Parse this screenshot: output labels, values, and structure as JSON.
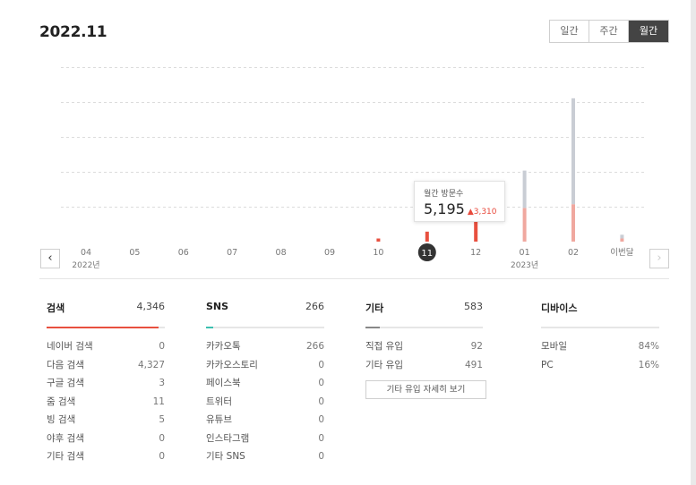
{
  "title": "2022.11",
  "period_tabs": [
    {
      "label": "일간",
      "active": false
    },
    {
      "label": "주간",
      "active": false
    },
    {
      "label": "월간",
      "active": true
    }
  ],
  "chart_data": {
    "type": "bar",
    "stacked": true,
    "categories": [
      "04",
      "05",
      "06",
      "07",
      "08",
      "09",
      "10",
      "11",
      "12",
      "01",
      "02",
      "이번달"
    ],
    "year_labels": {
      "04": "2022년",
      "01": "2023년"
    },
    "selected": "11",
    "series": [
      {
        "color": "#e8503f",
        "values": [
          0,
          0,
          0,
          0,
          0,
          0,
          250,
          800,
          1700,
          2700,
          3000,
          250
        ]
      },
      {
        "color": "#c9cdd4",
        "values": [
          0,
          0,
          0,
          0,
          0,
          0,
          0,
          0,
          0,
          3000,
          8500,
          300
        ]
      }
    ],
    "highlight_colors": {
      "selected": "#e8503f",
      "other": "#f0a89f"
    },
    "ylim": [
      0,
      14000
    ],
    "grid": true,
    "tooltip": {
      "label": "월간 방문수",
      "value": "5,195",
      "delta": "3,310",
      "delta_color": "#e84a3c"
    }
  },
  "stats": [
    {
      "title": "검색",
      "total": "4,346",
      "bar_color": "#e8503f",
      "bar_pct": 0.95,
      "rows": [
        {
          "label": "네이버 검색",
          "value": "0"
        },
        {
          "label": "다음 검색",
          "value": "4,327"
        },
        {
          "label": "구글 검색",
          "value": "3"
        },
        {
          "label": "줌 검색",
          "value": "11"
        },
        {
          "label": "빙 검색",
          "value": "5"
        },
        {
          "label": "야후 검색",
          "value": "0"
        },
        {
          "label": "기타 검색",
          "value": "0"
        }
      ]
    },
    {
      "title": "SNS",
      "total": "266",
      "bar_color": "#3cc0b0",
      "bar_pct": 0.06,
      "rows": [
        {
          "label": "카카오톡",
          "value": "266"
        },
        {
          "label": "카카오스토리",
          "value": "0"
        },
        {
          "label": "페이스북",
          "value": "0"
        },
        {
          "label": "트위터",
          "value": "0"
        },
        {
          "label": "유튜브",
          "value": "0"
        },
        {
          "label": "인스타그램",
          "value": "0"
        },
        {
          "label": "기타 SNS",
          "value": "0"
        }
      ]
    },
    {
      "title": "기타",
      "total": "583",
      "bar_color": "#888888",
      "bar_pct": 0.12,
      "rows": [
        {
          "label": "직접 유입",
          "value": "92"
        },
        {
          "label": "기타 유입",
          "value": "491"
        }
      ],
      "button": "기타 유입 자세히 보기"
    },
    {
      "title": "디바이스",
      "total": "",
      "bar_color": "#e6e6e6",
      "bar_pct": 0,
      "rows": [
        {
          "label": "모바일",
          "value": "84%"
        },
        {
          "label": "PC",
          "value": "16%"
        }
      ]
    }
  ],
  "icons": {
    "prev": "chevron-left-icon",
    "next": "chevron-right-icon"
  }
}
